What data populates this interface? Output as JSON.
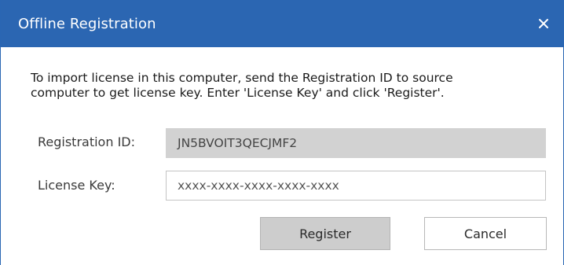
{
  "dialog": {
    "title": "Offline Registration",
    "close_icon": "close-icon",
    "accent_color": "#2b66b2"
  },
  "instructions": {
    "line1": "To import license in this computer, send the Registration ID to source",
    "line2": "computer to get license key. Enter 'License Key' and click 'Register'."
  },
  "registration": {
    "label": "Registration ID:",
    "value": "JN5BVOIT3QECJMF2"
  },
  "license": {
    "label": "License Key:",
    "placeholder": "xxxx-xxxx-xxxx-xxxx-xxxx"
  },
  "buttons": {
    "register_label": "Register",
    "cancel_label": "Cancel"
  }
}
